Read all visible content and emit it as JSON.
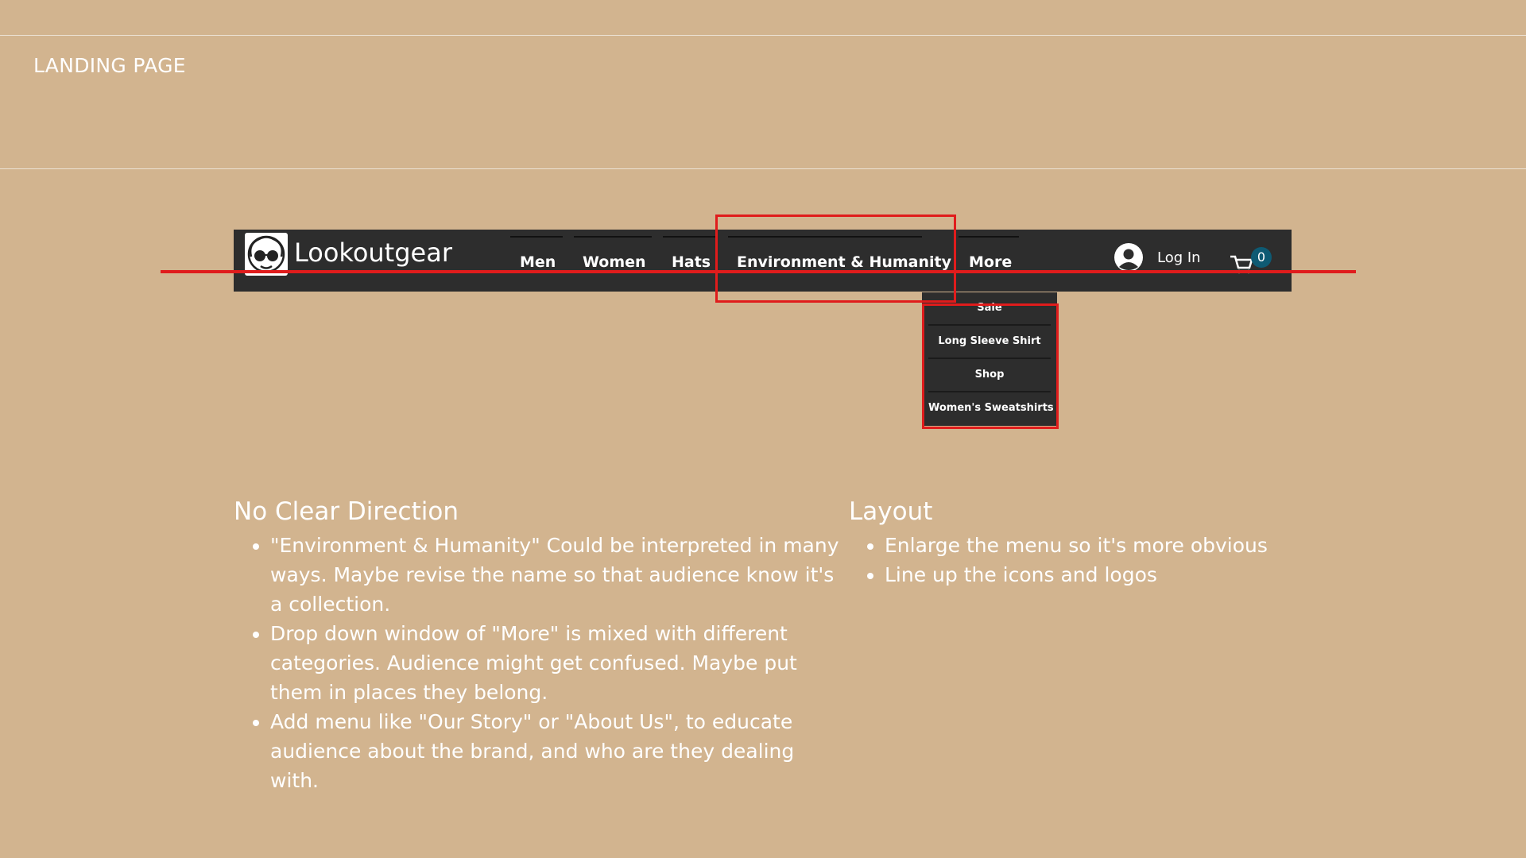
{
  "slide": {
    "title": "LANDING PAGE"
  },
  "site": {
    "brand": "Lookoutgear",
    "nav": [
      "Men",
      "Women",
      "Hats",
      "Environment & Humanity",
      "More"
    ],
    "login_label": "Log In",
    "cart_count": "0",
    "dropdown": [
      "Sale",
      "Long Sleeve Shirt",
      "Shop",
      "Women's Sweatshirts"
    ]
  },
  "notes": {
    "left": {
      "heading": "No Clear Direction",
      "items": [
        "\"Environment & Humanity\" Could be interpreted in many ways. Maybe revise the name so that audience know it's a collection.",
        "Drop down window of \"More\" is mixed with different categories. Audience might get confused. Maybe put them in places they belong.",
        "Add menu like \"Our Story\" or \"About Us\", to educate audience about the brand, and who are they dealing with."
      ]
    },
    "right": {
      "heading": "Layout",
      "items": [
        "Enlarge the menu so it's more obvious",
        "Line up the icons and logos"
      ]
    }
  },
  "colors": {
    "background": "#d2b48f",
    "navbar": "#2d2d2d",
    "annotation_red": "#e01c1c",
    "cart_badge": "#0e5a73"
  }
}
